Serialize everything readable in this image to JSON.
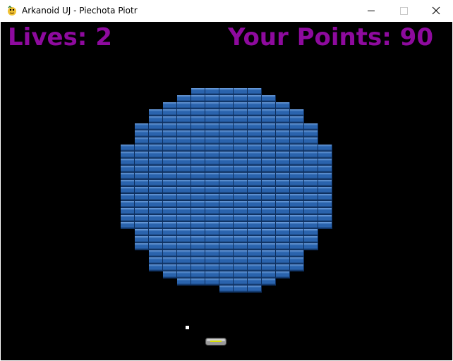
{
  "window": {
    "title": "Arkanoid UJ - Piechota Piotr"
  },
  "hud": {
    "lives_text": "Lives: 2",
    "points_text": "Your Points: 90",
    "lives": 2,
    "points": 90,
    "text_color": "#8e0a9e"
  },
  "colors": {
    "background": "#000000",
    "brick_fill": "#2a63ad",
    "brick_light": "#6fa0dd",
    "brick_dark": "#0e2f5e",
    "ball": "#ffffff",
    "paddle": "#a8a8a8",
    "paddle_stripe": "#d8e000"
  },
  "icons": {
    "app": "pygame-snake-icon",
    "minimize": "minimize-icon",
    "maximize": "maximize-icon",
    "close": "close-icon"
  },
  "bricks": {
    "rows": [
      [
        5,
        9
      ],
      [
        4,
        10
      ],
      [
        3,
        11
      ],
      [
        2,
        12
      ],
      [
        2,
        12
      ],
      [
        1,
        13
      ],
      [
        1,
        13
      ],
      [
        1,
        13
      ],
      [
        0,
        14
      ],
      [
        0,
        14
      ],
      [
        0,
        14
      ],
      [
        0,
        14
      ],
      [
        0,
        14
      ],
      [
        0,
        14
      ],
      [
        0,
        14
      ],
      [
        0,
        14
      ],
      [
        0,
        14
      ],
      [
        0,
        14
      ],
      [
        0,
        14
      ],
      [
        0,
        14
      ],
      [
        1,
        13
      ],
      [
        1,
        13
      ],
      [
        1,
        13
      ],
      [
        2,
        12
      ],
      [
        2,
        12
      ],
      [
        2,
        12
      ],
      [
        3,
        11
      ],
      [
        4,
        10
      ],
      [
        7,
        9
      ]
    ]
  }
}
